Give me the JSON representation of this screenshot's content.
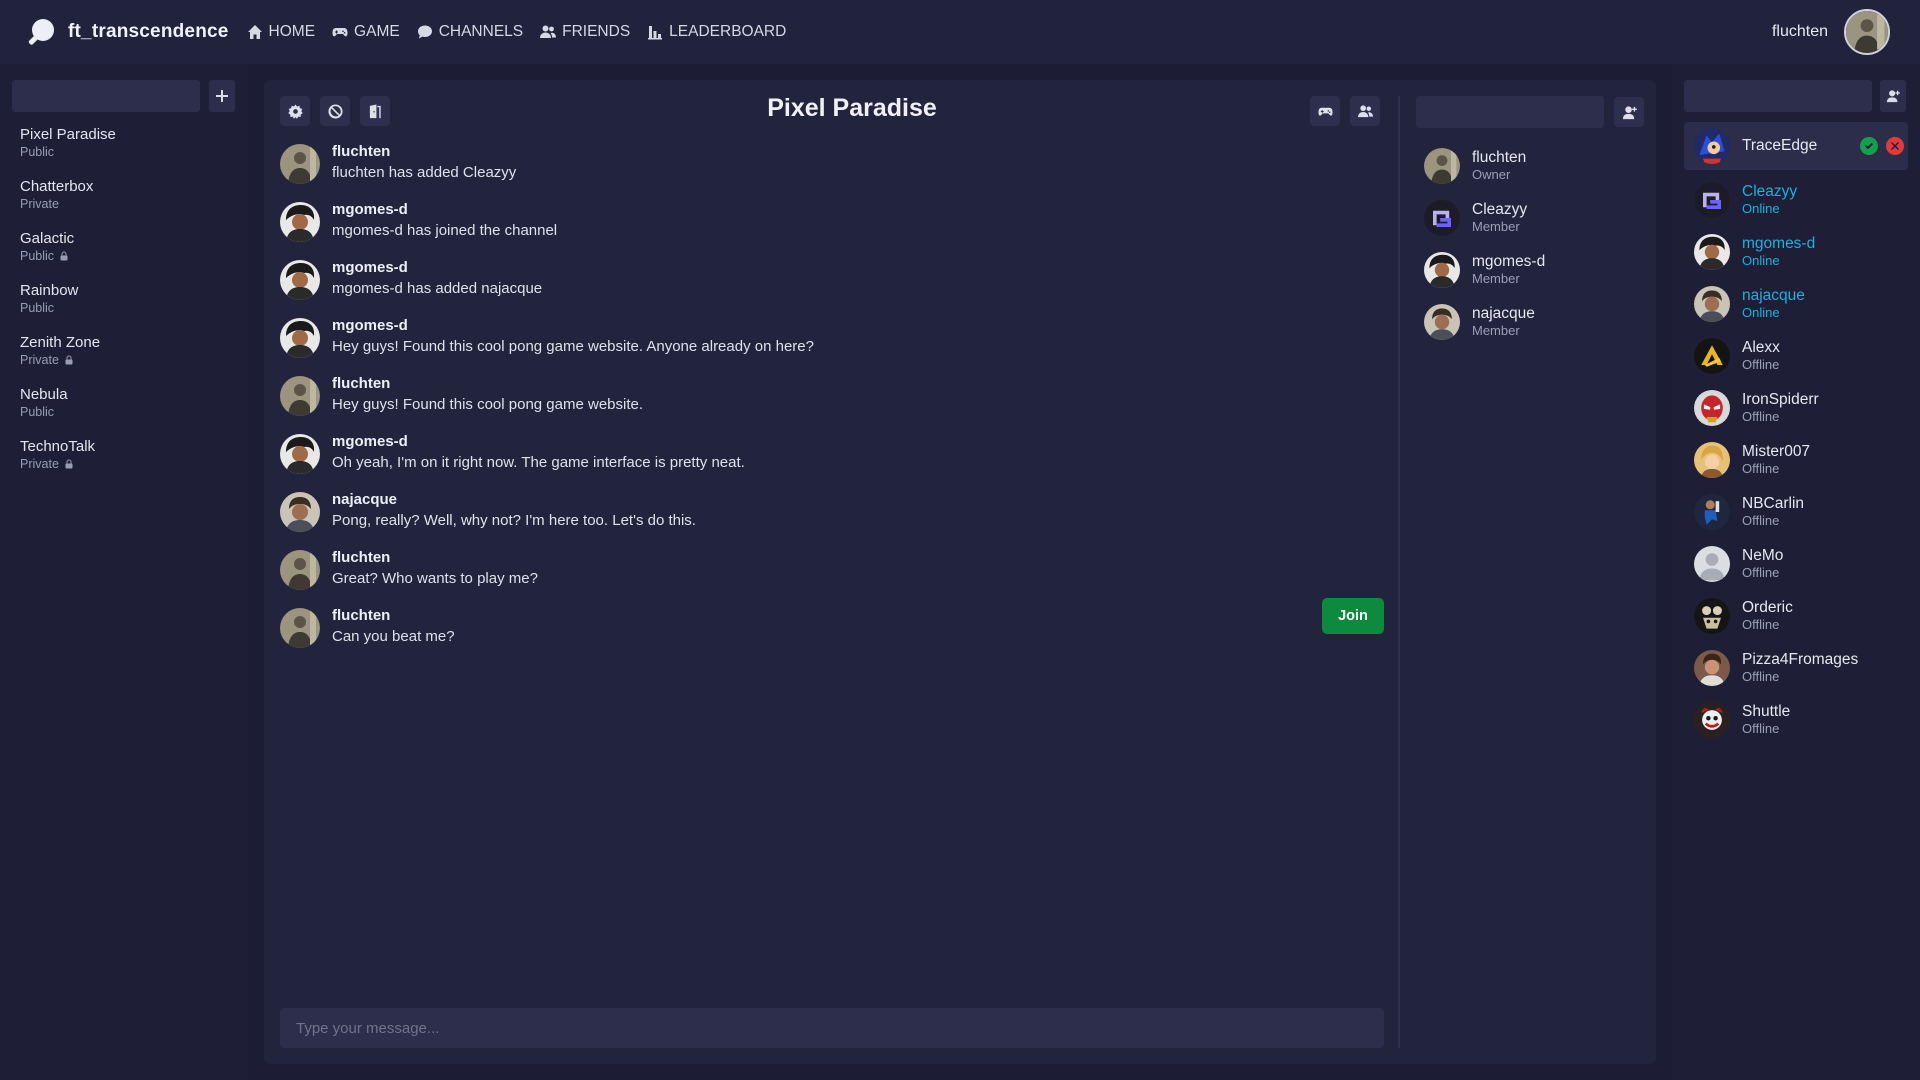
{
  "app": {
    "name": "ft_transcendence"
  },
  "nav": [
    {
      "label": "HOME",
      "icon": "home-icon"
    },
    {
      "label": "GAME",
      "icon": "gamepad-icon"
    },
    {
      "label": "CHANNELS",
      "icon": "chat-bubble-icon"
    },
    {
      "label": "FRIENDS",
      "icon": "users-icon"
    },
    {
      "label": "LEADERBOARD",
      "icon": "bar-chart-icon"
    }
  ],
  "current_user": {
    "name": "fluchten"
  },
  "channels": [
    {
      "name": "Pixel Paradise",
      "visibility": "Public",
      "locked": false
    },
    {
      "name": "Chatterbox",
      "visibility": "Private",
      "locked": false
    },
    {
      "name": "Galactic",
      "visibility": "Public",
      "locked": true
    },
    {
      "name": "Rainbow",
      "visibility": "Public",
      "locked": false
    },
    {
      "name": "Zenith Zone",
      "visibility": "Private",
      "locked": true
    },
    {
      "name": "Nebula",
      "visibility": "Public",
      "locked": false
    },
    {
      "name": "TechnoTalk",
      "visibility": "Private",
      "locked": true
    }
  ],
  "chat": {
    "title": "Pixel Paradise",
    "input_placeholder": "Type your message...",
    "join_label": "Join",
    "messages": [
      {
        "author": "fluchten",
        "text": "fluchten has added Cleazyy"
      },
      {
        "author": "mgomes-d",
        "text": "mgomes-d has joined the channel"
      },
      {
        "author": "mgomes-d",
        "text": "mgomes-d has added najacque"
      },
      {
        "author": "mgomes-d",
        "text": "Hey guys! Found this cool pong game website. Anyone already on here?"
      },
      {
        "author": "fluchten",
        "text": "Hey guys! Found this cool pong game website."
      },
      {
        "author": "mgomes-d",
        "text": "Oh yeah, I'm on it right now. The game interface is pretty neat."
      },
      {
        "author": "najacque",
        "text": "Pong, really? Well, why not? I'm here too. Let's do this."
      },
      {
        "author": "fluchten",
        "text": "Great? Who wants to play me?"
      },
      {
        "author": "fluchten",
        "text": "Can you beat me?"
      }
    ]
  },
  "members": [
    {
      "name": "fluchten",
      "role": "Owner"
    },
    {
      "name": "Cleazyy",
      "role": "Member"
    },
    {
      "name": "mgomes-d",
      "role": "Member"
    },
    {
      "name": "najacque",
      "role": "Member"
    }
  ],
  "friends": [
    {
      "name": "TraceEdge",
      "status": ""
    },
    {
      "name": "Cleazyy",
      "status": "Online"
    },
    {
      "name": "mgomes-d",
      "status": "Online"
    },
    {
      "name": "najacque",
      "status": "Online"
    },
    {
      "name": "Alexx",
      "status": "Offline"
    },
    {
      "name": "IronSpiderr",
      "status": "Offline"
    },
    {
      "name": "Mister007",
      "status": "Offline"
    },
    {
      "name": "NBCarlin",
      "status": "Offline"
    },
    {
      "name": "NeMo",
      "status": "Offline"
    },
    {
      "name": "Orderic",
      "status": "Offline"
    },
    {
      "name": "Pizza4Fromages",
      "status": "Offline"
    },
    {
      "name": "Shuttle",
      "status": "Offline"
    }
  ],
  "colors": {
    "background": "#1c1d34",
    "panel": "#22233c",
    "accent_online": "#1fb0e0",
    "join_button": "#0d8a3e",
    "accept": "#14a04a",
    "reject": "#e23a3a"
  }
}
